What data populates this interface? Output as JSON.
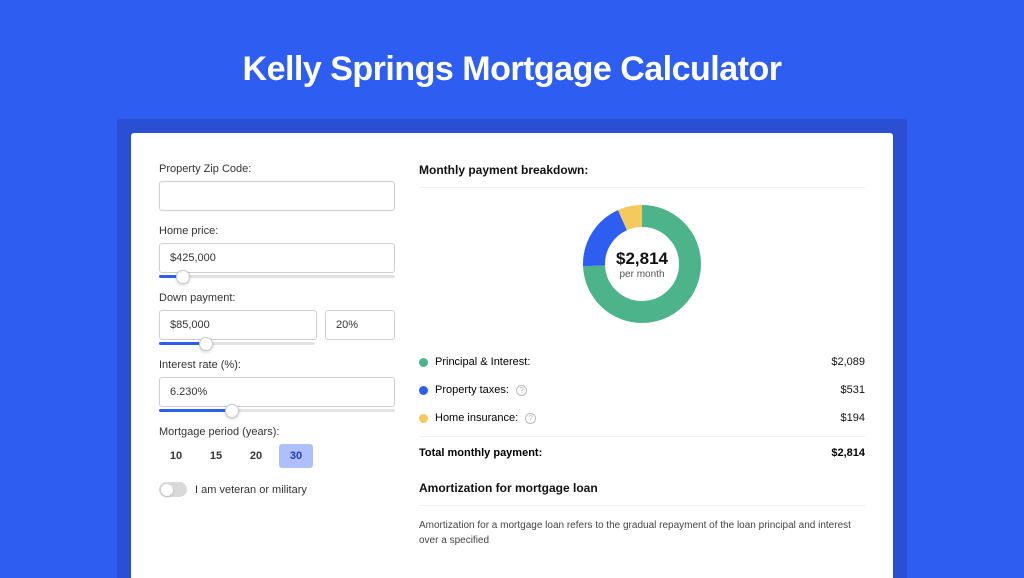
{
  "title": "Kelly Springs Mortgage Calculator",
  "form": {
    "zip_label": "Property Zip Code:",
    "zip_value": "",
    "home_price_label": "Home price:",
    "home_price_value": "$425,000",
    "home_price_slider_pct": 10,
    "down_payment_label": "Down payment:",
    "down_payment_value": "$85,000",
    "down_payment_pct_value": "20%",
    "down_payment_slider_pct": 20,
    "interest_label": "Interest rate (%):",
    "interest_value": "6.230%",
    "interest_slider_pct": 31,
    "period_label": "Mortgage period (years):",
    "period_options": [
      "10",
      "15",
      "20",
      "30"
    ],
    "period_selected": "30",
    "veteran_label": "I am veteran or military"
  },
  "breakdown": {
    "heading": "Monthly payment breakdown:",
    "total_amount": "$2,814",
    "total_sub": "per month",
    "rows": [
      {
        "label": "Principal & Interest:",
        "value": "$2,089",
        "color": "green",
        "info": false
      },
      {
        "label": "Property taxes:",
        "value": "$531",
        "color": "blue",
        "info": true
      },
      {
        "label": "Home insurance:",
        "value": "$194",
        "color": "yellow",
        "info": true
      }
    ],
    "total_label": "Total monthly payment:",
    "total_value": "$2,814"
  },
  "amortization": {
    "heading": "Amortization for mortgage loan",
    "text": "Amortization for a mortgage loan refers to the gradual repayment of the loan principal and interest over a specified"
  },
  "chart_data": {
    "type": "pie",
    "title": "Monthly payment breakdown",
    "categories": [
      "Principal & Interest",
      "Property taxes",
      "Home insurance"
    ],
    "values": [
      2089,
      531,
      194
    ],
    "colors": [
      "#4db38a",
      "#2e5ef1",
      "#f4c95d"
    ],
    "center_label": "$2,814 per month"
  }
}
